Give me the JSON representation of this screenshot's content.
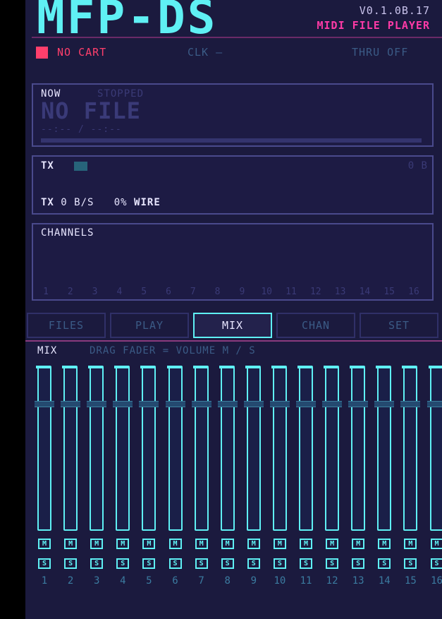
{
  "app": {
    "logo": "MFP-DS",
    "version": "V0.1.0B.17",
    "subtitle": "MIDI FILE PLAYER"
  },
  "status": {
    "cart": "NO CART",
    "clock": "CLK —",
    "thru": "THRU OFF",
    "colors": {
      "cart_led": "#ff3f6c"
    }
  },
  "now_panel": {
    "label": "NOW",
    "state": "STOPPED",
    "file": "NO FILE",
    "time": "--:-- / --:--",
    "progress": 0
  },
  "tx_panel": {
    "label": "TX",
    "bytes": "0 B",
    "rate_prefix": "TX",
    "rate": "0 B/S",
    "wire_pct": "0%",
    "wire_label": "WIRE"
  },
  "channels_panel": {
    "title": "CHANNELS",
    "numbers": [
      "1",
      "2",
      "3",
      "4",
      "5",
      "6",
      "7",
      "8",
      "9",
      "10",
      "11",
      "12",
      "13",
      "14",
      "15",
      "16"
    ]
  },
  "tabs": [
    {
      "label": "FILES",
      "active": false
    },
    {
      "label": "PLAY",
      "active": false
    },
    {
      "label": "MIX",
      "active": true
    },
    {
      "label": "CHAN",
      "active": false
    },
    {
      "label": "SET",
      "active": false
    }
  ],
  "mixer": {
    "title": "MIX",
    "hint": "DRAG FADER = VOLUME   M / S",
    "mute_label": "M",
    "solo_label": "S",
    "level": 0.78,
    "channels": [
      "1",
      "2",
      "3",
      "4",
      "5",
      "6",
      "7",
      "8",
      "9",
      "10",
      "11",
      "12",
      "13",
      "14",
      "15",
      "16"
    ]
  },
  "colors": {
    "accent": "#5ff0f4",
    "magenta": "#ff3aa6",
    "background": "#1b1a3e"
  }
}
